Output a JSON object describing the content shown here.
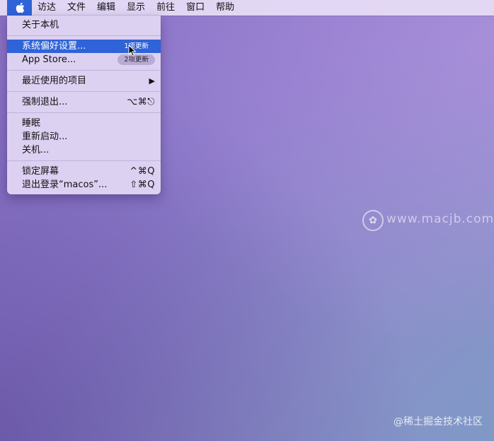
{
  "menubar": {
    "apple_icon": "apple-logo-icon",
    "items": [
      {
        "label": "访达"
      },
      {
        "label": "文件"
      },
      {
        "label": "编辑"
      },
      {
        "label": "显示"
      },
      {
        "label": "前往"
      },
      {
        "label": "窗口"
      },
      {
        "label": "帮助"
      }
    ]
  },
  "apple_menu": {
    "about": "关于本机",
    "system_prefs": {
      "label": "系统偏好设置...",
      "badge": "1项更新"
    },
    "app_store": {
      "label": "App Store...",
      "badge": "2项更新"
    },
    "recent_items": {
      "label": "最近使用的项目",
      "arrow": "▶"
    },
    "force_quit": {
      "label": "强制退出...",
      "shortcut": "⌥⌘⎋"
    },
    "sleep": "睡眠",
    "restart": "重新启动...",
    "shutdown": "关机...",
    "lock_screen": {
      "label": "锁定屏幕",
      "shortcut": "^⌘Q"
    },
    "logout": {
      "label": "退出登录“macos”...",
      "shortcut": "⇧⌘Q"
    }
  },
  "watermark": {
    "text": "www.macjb.com"
  },
  "credit": "@稀土掘金技术社区",
  "colors": {
    "highlight": "#2f63d8"
  }
}
